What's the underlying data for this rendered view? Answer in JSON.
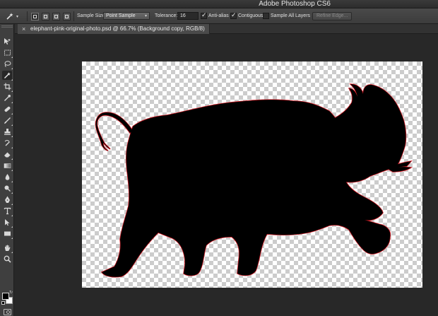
{
  "window": {
    "app_title": "Adobe Photoshop CS6"
  },
  "options_bar": {
    "sample_size_label": "Sample Size:",
    "sample_size_value": "Point Sample",
    "tolerance_label": "Tolerance:",
    "tolerance_value": "16",
    "anti_alias_label": "Anti-alias",
    "anti_alias_checked": true,
    "contiguous_label": "Contiguous",
    "contiguous_checked": true,
    "sample_all_layers_label": "Sample All Layers",
    "sample_all_layers_checked": false,
    "refine_edge_label": "Refine Edge..."
  },
  "document": {
    "tab_close": "×",
    "tab_title": "elephant-pink-original-photo.psd @ 66.7% (Background copy, RGB/8)"
  },
  "toolbox": {
    "tools": [
      "move-icon",
      "marquee-icon",
      "lasso-icon",
      "magic-wand-icon",
      "crop-icon",
      "eyedropper-icon",
      "healing-brush-icon",
      "brush-icon",
      "clone-stamp-icon",
      "history-brush-icon",
      "eraser-icon",
      "gradient-icon",
      "blur-icon",
      "dodge-icon",
      "pen-icon",
      "type-icon",
      "path-selection-icon",
      "rectangle-shape-icon",
      "hand-icon",
      "zoom-icon"
    ],
    "active_tool": "magic-wand-icon",
    "foreground_color": "#000000",
    "background_color": "#ffffff"
  },
  "colors": {
    "selection_edge": "#e0202a",
    "silhouette": "#000000"
  }
}
